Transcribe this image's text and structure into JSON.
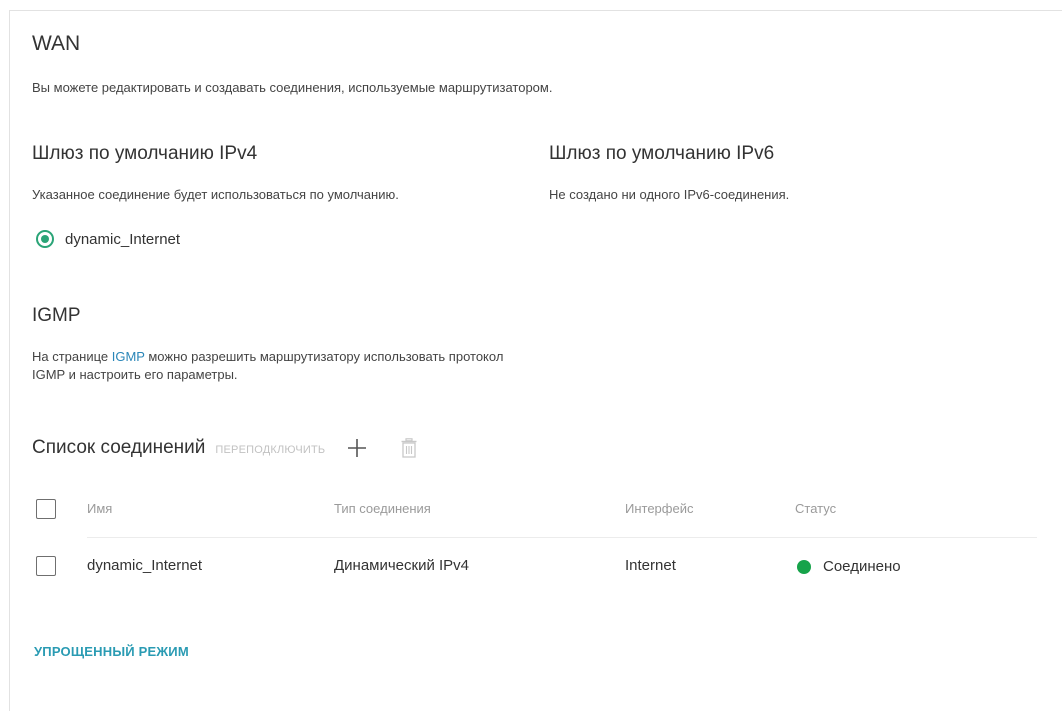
{
  "page": {
    "title": "WAN",
    "description": "Вы можете редактировать и создавать соединения, используемые маршрутизатором."
  },
  "gateway_ipv4": {
    "title": "Шлюз по умолчанию IPv4",
    "description": "Указанное соединение будет использоваться по умолчанию.",
    "selected_connection": "dynamic_Internet",
    "accent_color": "#2aa477"
  },
  "gateway_ipv6": {
    "title": "Шлюз по умолчанию IPv6",
    "description": "Не создано ни одного IPv6-соединения."
  },
  "igmp": {
    "title": "IGMP",
    "desc_prefix": "На странице ",
    "link_text": "IGMP",
    "desc_suffix": " можно разрешить маршрутизатору использовать протокол IGMP и настроить его параметры."
  },
  "connections": {
    "title": "Список соединений",
    "reconnect_label": "ПЕРЕПОДКЛЮЧИТЬ",
    "add_icon": "plus-icon",
    "delete_icon": "trash-icon",
    "columns": {
      "name": "Имя",
      "type": "Тип соединения",
      "interface": "Интерфейс",
      "status": "Статус"
    },
    "rows": [
      {
        "name": "dynamic_Internet",
        "type": "Динамический IPv4",
        "interface": "Internet",
        "status": "Соединено",
        "status_color": "#16a34a"
      }
    ]
  },
  "footer": {
    "simple_mode_label": "УПРОЩЕННЫЙ РЕЖИМ",
    "link_color": "#2a9bb3"
  }
}
